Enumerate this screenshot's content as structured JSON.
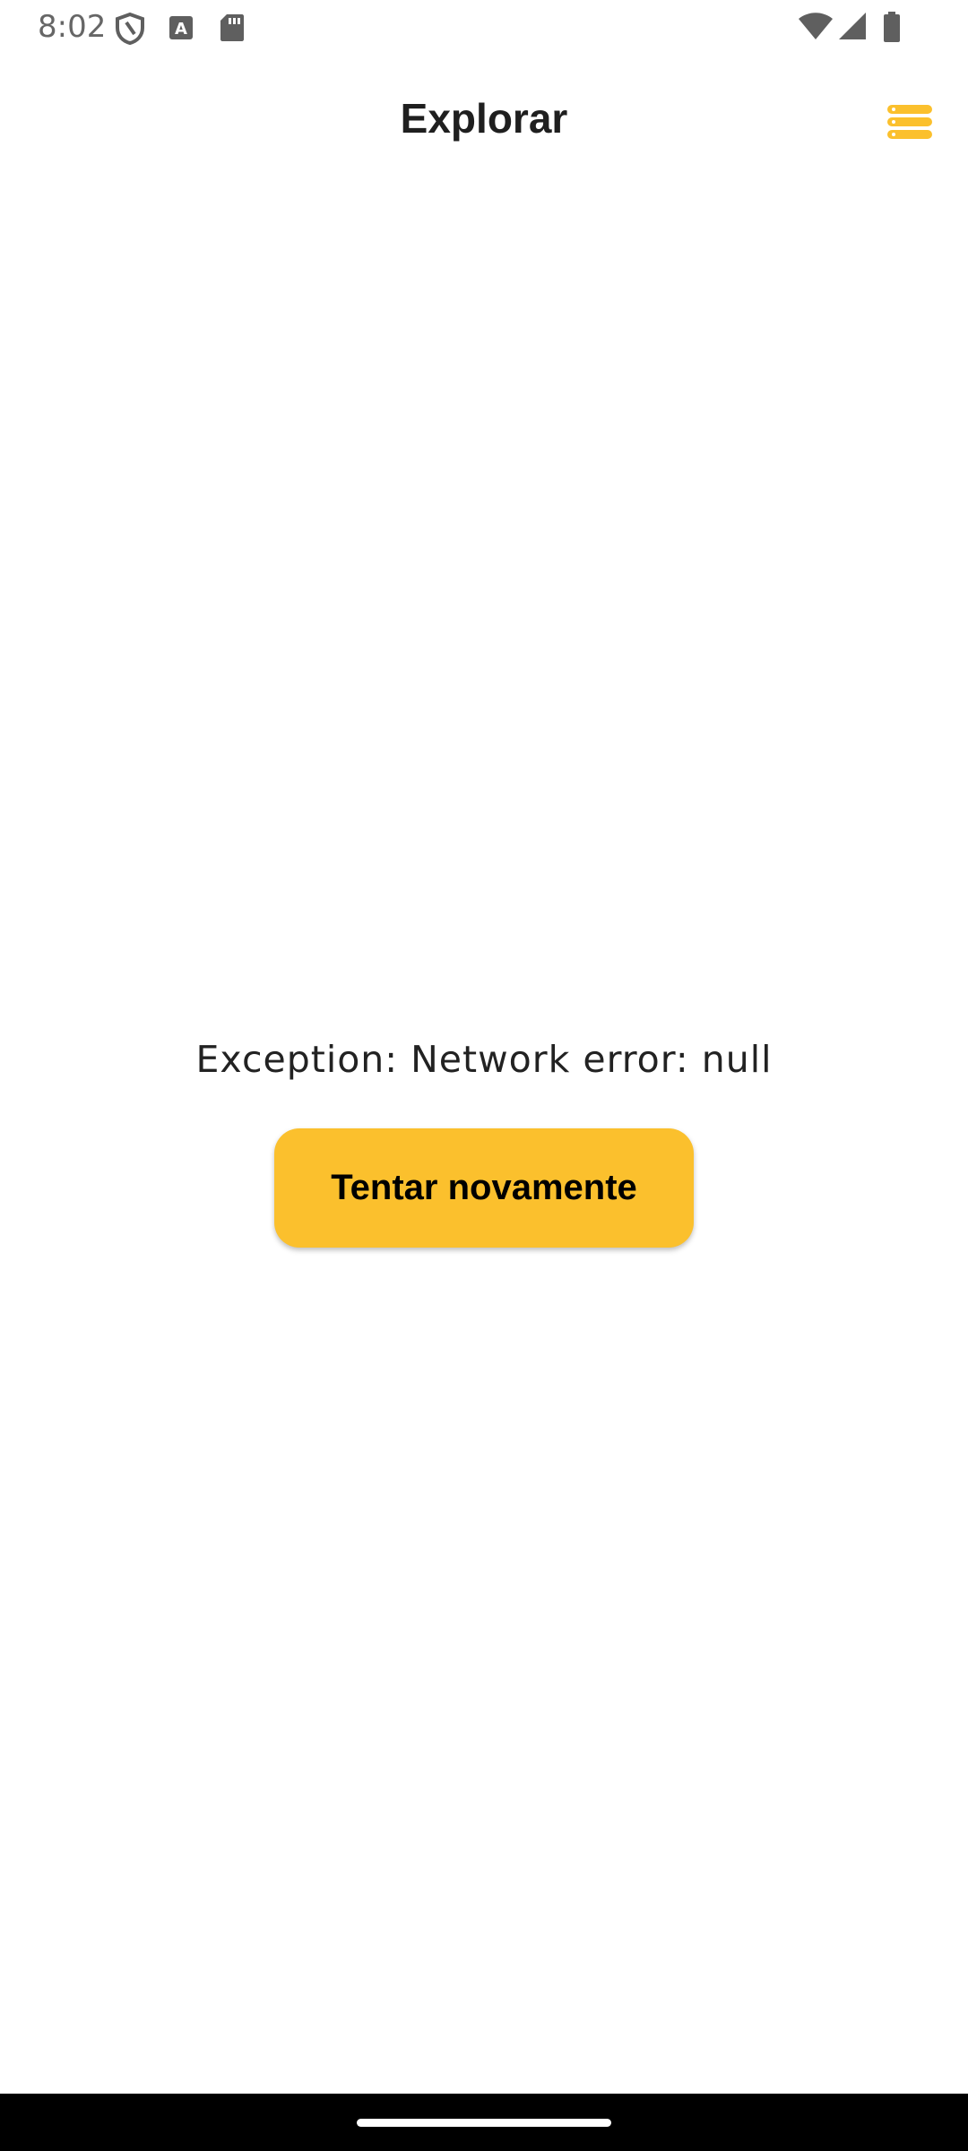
{
  "status_bar": {
    "time": "8:02",
    "icons": [
      "shield-icon",
      "font-download-icon",
      "sd-card-icon",
      "wifi-icon",
      "cell-signal-icon",
      "battery-icon"
    ]
  },
  "header": {
    "title": "Explorar",
    "menu_icon": "stacked-list-icon"
  },
  "error": {
    "message": "Exception: Network error: null",
    "retry_label": "Tentar novamente"
  },
  "colors": {
    "accent": "#fbc02d",
    "title_text": "#1f1f1f",
    "background": "#ffffff",
    "nav_bar": "#000000"
  }
}
